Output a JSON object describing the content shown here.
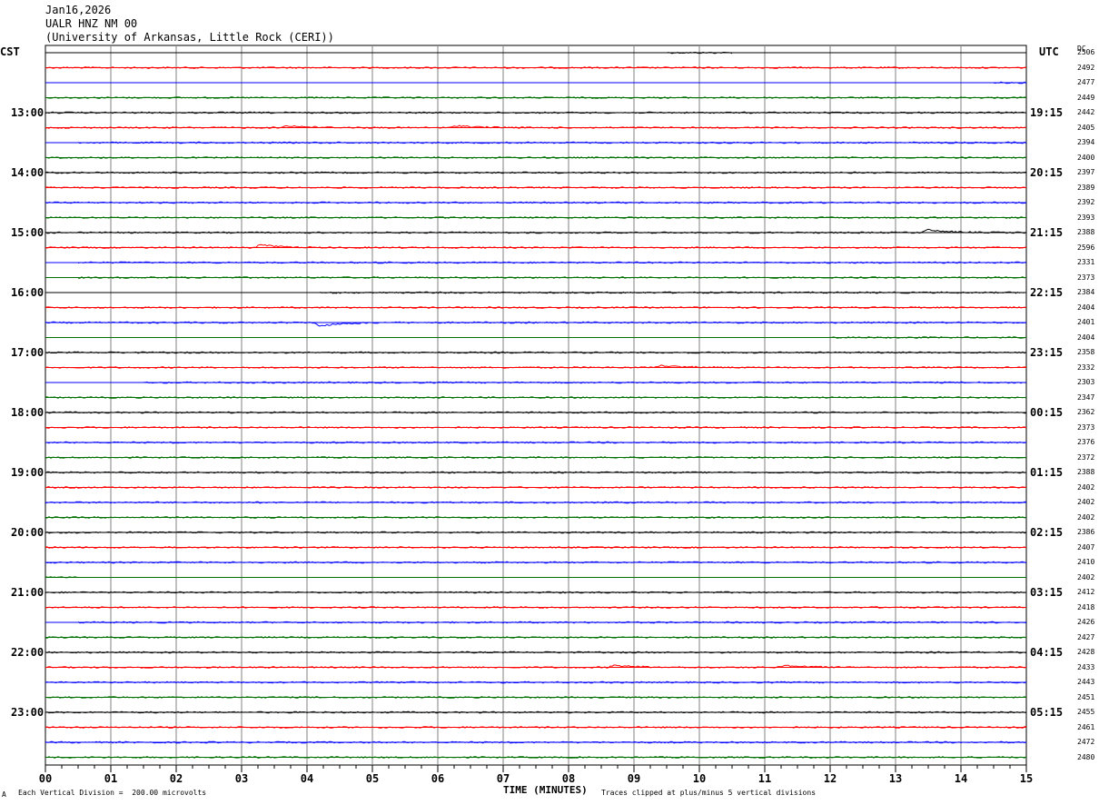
{
  "header": {
    "date": "Jan16,2026",
    "station": "UALR HNZ NM 00",
    "institution": "(University of Arkansas, Little Rock (CERI))"
  },
  "labels": {
    "left_tz": "CST",
    "right_tz": "UTC",
    "dc_header": "DC"
  },
  "footer": {
    "scale_note": "Each Vertical Division =  200.00 microvolts",
    "clip_note": "Traces clipped at plus/minus 5 vertical divisions",
    "mark": "A"
  },
  "colors": {
    "trace_cycle": [
      "#000000",
      "#ff0000",
      "#0000ff",
      "#007000"
    ],
    "grid": "#808080"
  },
  "chart_data": {
    "type": "line",
    "title": "",
    "xlabel": "TIME (MINUTES)",
    "xlim": [
      0,
      15
    ],
    "x_ticks": [
      "00",
      "01",
      "02",
      "03",
      "04",
      "05",
      "06",
      "07",
      "08",
      "09",
      "10",
      "11",
      "12",
      "13",
      "14",
      "15"
    ],
    "left_hour_labels": [
      "13:00",
      "14:00",
      "15:00",
      "16:00",
      "17:00",
      "18:00",
      "19:00",
      "20:00",
      "21:00",
      "22:00",
      "23:00"
    ],
    "right_hour_labels": [
      "19:15",
      "20:15",
      "21:15",
      "22:15",
      "23:15",
      "00:15",
      "01:15",
      "02:15",
      "03:15",
      "04:15",
      "05:15"
    ],
    "label_every_traces": 4,
    "first_label_trace": 4,
    "trace_count": 48,
    "dc_values": [
      2506,
      2492,
      2477,
      2449,
      2442,
      2405,
      2394,
      2400,
      2397,
      2389,
      2392,
      2393,
      2388,
      2596,
      2331,
      2373,
      2384,
      2404,
      2401,
      2404,
      2358,
      2332,
      2303,
      2347,
      2362,
      2373,
      2376,
      2372,
      2388,
      2402,
      2402,
      2402,
      2386,
      2407,
      2410,
      2402,
      2412,
      2418,
      2426,
      2427,
      2428,
      2433,
      2443,
      2451,
      2455,
      2461,
      2472,
      2480
    ],
    "trace_start_minutes": [
      9.5,
      0,
      14.5,
      0,
      0,
      0,
      0.5,
      0,
      0,
      0,
      0,
      0,
      0,
      0,
      0.5,
      0.5,
      4.2,
      0,
      0,
      12,
      0,
      0,
      1.5,
      0,
      0,
      0,
      0,
      0,
      0,
      0,
      0,
      0,
      0,
      0,
      0,
      0,
      0,
      0,
      0.5,
      0,
      0,
      0,
      0,
      0,
      0,
      0,
      0,
      0
    ],
    "trace_end_minutes": [
      10.5,
      15,
      15,
      15,
      15,
      15,
      15,
      15,
      15,
      15,
      15,
      15,
      15,
      15,
      15,
      15,
      15,
      15,
      15,
      15,
      15,
      15,
      15,
      15,
      15,
      15,
      15,
      15,
      15,
      15,
      15,
      15,
      15,
      15,
      15,
      0.5,
      15,
      15,
      15,
      15,
      15,
      15,
      15,
      15,
      15,
      15,
      15,
      15
    ],
    "events": [
      {
        "trace": 5,
        "minute": 3.6,
        "offset": -3
      },
      {
        "trace": 5,
        "minute": 6.2,
        "offset": -3
      },
      {
        "trace": 12,
        "minute": 13.4,
        "offset": -4
      },
      {
        "trace": 13,
        "minute": 3.2,
        "offset": -4
      },
      {
        "trace": 18,
        "minute": 4.1,
        "offset": 5
      },
      {
        "trace": 21,
        "minute": 9.3,
        "offset": -3
      },
      {
        "trace": 41,
        "minute": 8.6,
        "offset": -3
      },
      {
        "trace": 41,
        "minute": 11.2,
        "offset": -3
      }
    ]
  }
}
